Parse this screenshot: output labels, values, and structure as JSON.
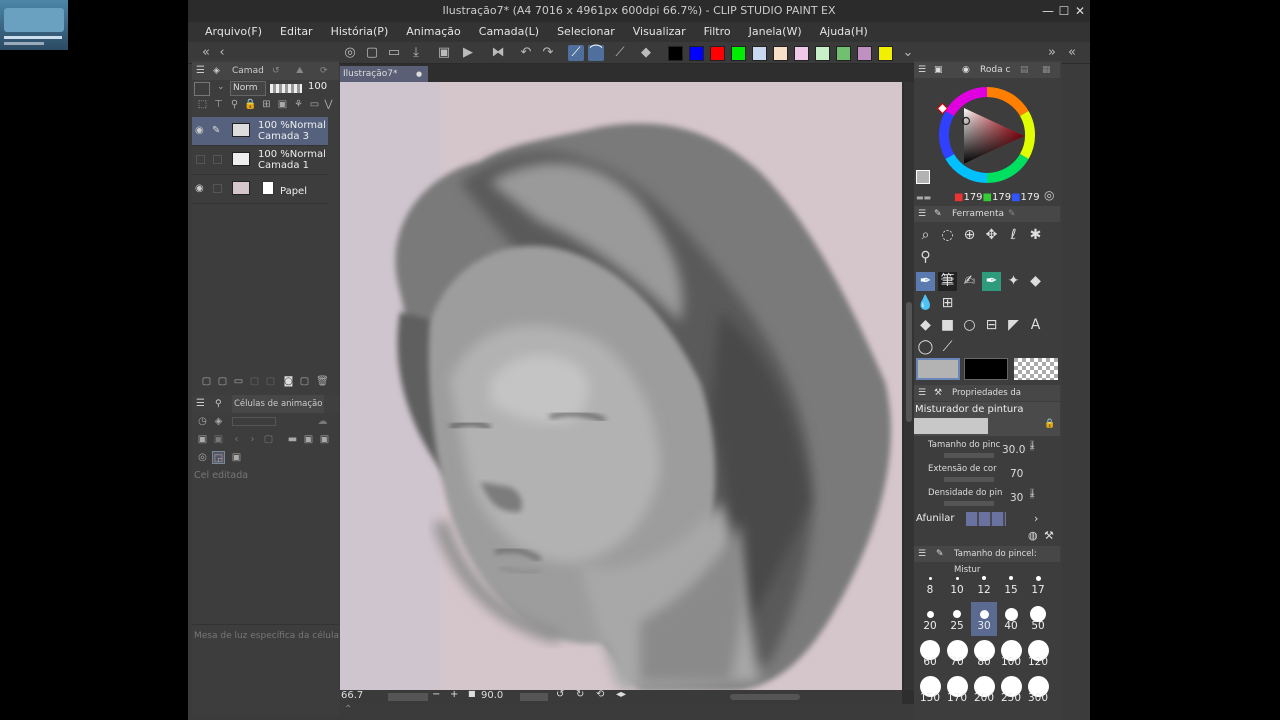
{
  "window": {
    "title": "Ilustração7* (A4 7016 x 4961px 600dpi 66.7%)  - CLIP STUDIO PAINT EX",
    "minimize_icon": "minimize-icon",
    "maximize_icon": "maximize-icon",
    "close_icon": "close-icon"
  },
  "menu": [
    "Arquivo(F)",
    "Editar",
    "História(P)",
    "Animação",
    "Camada(L)",
    "Selecionar",
    "Visualizar",
    "Filtro",
    "Janela(W)",
    "Ajuda(H)"
  ],
  "palette_colors": [
    "#000000",
    "#0000ff",
    "#ff0000",
    "#00ee00",
    "#c8d8f0",
    "#f8e0c8",
    "#f0c8e8",
    "#c8f0c8",
    "#70c070",
    "#c090c0",
    "#f0f000"
  ],
  "layer_panel": {
    "tab_label": "Camad",
    "blend_mode": "Norm",
    "opacity": "100",
    "layers": [
      {
        "line1": "100 %Normal",
        "line2": "Camada 3",
        "selected": true,
        "visible": true
      },
      {
        "line1": "100 %Normal",
        "line2": "Camada 1",
        "selected": false,
        "visible": false
      },
      {
        "line1": "",
        "line2": "Papel",
        "selected": false,
        "visible": true
      }
    ]
  },
  "animation_panel": {
    "title": "Células de animação",
    "cel_label": "Cel editada",
    "lightbox_label": "Mesa de luz específica da célula"
  },
  "document": {
    "tab_label": "Ilustração7*"
  },
  "status": {
    "zoom": "66.7",
    "angle": "90.0"
  },
  "color_wheel": {
    "tab_label": "Roda c",
    "r": "179",
    "g": "179",
    "b": "179"
  },
  "tool_panel": {
    "tab_label": "Ferramenta"
  },
  "tool_properties": {
    "tab_label": "Propriedades da ferramenta",
    "subtool_name": "Misturador de pintura",
    "props": [
      {
        "label": "Tamanho do pinc",
        "value": "30.0"
      },
      {
        "label": "Extensão de cor",
        "value": "70"
      },
      {
        "label": "Densidade do pin",
        "value": "30"
      }
    ],
    "sharpen_label": "Afunilar"
  },
  "brush_size_panel": {
    "tab_label": "Tamanho do pincel: Mistur",
    "sizes": [
      "8",
      "10",
      "12",
      "15",
      "17",
      "20",
      "25",
      "30",
      "40",
      "50",
      "60",
      "70",
      "80",
      "100",
      "120",
      "150",
      "170",
      "200",
      "250",
      "300"
    ],
    "selected": "30"
  }
}
